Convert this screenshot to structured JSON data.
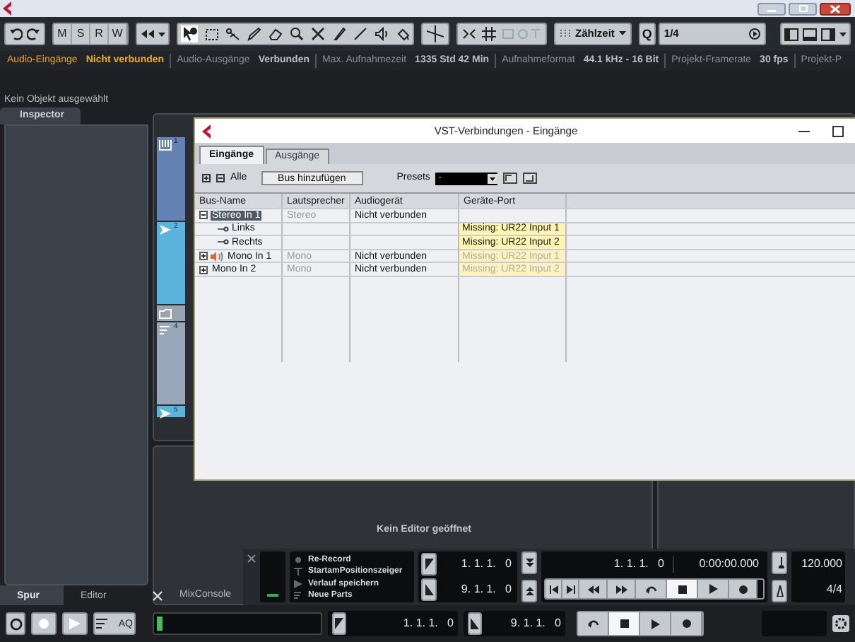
{
  "toolbar": {
    "automation_buttons": [
      "M",
      "S",
      "R",
      "W"
    ],
    "time_format": "Zählzeit",
    "quantize_label": "Q",
    "quantize_value": "1/4"
  },
  "info_line": [
    {
      "label": "Audio-Eingänge",
      "value": "Nicht verbunden",
      "warning": true
    },
    {
      "label": "Audio-Ausgänge",
      "value": "Verbunden",
      "warning": false
    },
    {
      "label": "Max. Aufnahmezeit",
      "value": "1335 Std 42 Min",
      "warning": false
    },
    {
      "label": "Aufnahmeformat",
      "value": "44.1 kHz - 16 Bit",
      "warning": false
    },
    {
      "label": "Projekt-Framerate",
      "value": "30 fps",
      "warning": false
    },
    {
      "label": "Projekt-P",
      "warning": false
    }
  ],
  "status": "Kein Objekt ausgewählt",
  "inspector_tab": "Inspector",
  "tracks": [
    {
      "number": "1",
      "kind": "instrument",
      "color": "#6482b4"
    },
    {
      "number": "2",
      "kind": "audio",
      "color": "#5ab4dc"
    },
    {
      "kind": "folder",
      "color": "#9aa4ae"
    },
    {
      "number": "4",
      "kind": "midi",
      "color": "#98a8ba"
    },
    {
      "number": "5",
      "kind": "audio",
      "color": "#5ab4dc"
    }
  ],
  "dialog": {
    "title": "VST-Verbindungen - Eingänge",
    "tabs": [
      {
        "label": "Eingänge",
        "selected": true
      },
      {
        "label": "Ausgänge",
        "selected": false
      }
    ],
    "expand_label": "Alle",
    "add_button": "Bus hinzufügen",
    "presets_label": "Presets",
    "presets_value": "-",
    "columns": [
      "Bus-Name",
      "Lautsprecher",
      "Audiogerät",
      "Geräte-Port"
    ],
    "rows": [
      {
        "name": "Stereo In 1",
        "speaker": "Stereo",
        "device": "Nicht verbunden",
        "selected": true,
        "expanded": true,
        "monitor": false,
        "children": [
          {
            "name": "Links",
            "port": "Missing: UR22 Input 1",
            "active": true
          },
          {
            "name": "Rechts",
            "port": "Missing: UR22 Input 2",
            "active": true
          }
        ]
      },
      {
        "name": "Mono In 1",
        "speaker": "Mono",
        "device": "Nicht verbunden",
        "port": "Missing: UR22 Input 1",
        "active": false,
        "selected": false,
        "expanded": false,
        "monitor": true
      },
      {
        "name": "Mono In 2",
        "speaker": "Mono",
        "device": "Nicht verbunden",
        "port": "Missing: UR22 Input 2",
        "active": false,
        "selected": false,
        "expanded": false,
        "monitor": false
      }
    ]
  },
  "editor_message": "Kein Editor geöffnet",
  "bottom_tabs": [
    {
      "label": "Spur",
      "selected": true
    },
    {
      "label": "Editor",
      "selected": false
    },
    {
      "label": "MixConsole",
      "selected": false
    }
  ],
  "transport": {
    "record_modes": [
      "Re-Record",
      "StartamPositionszeiger",
      "Verlauf speichern",
      "Neue Parts"
    ],
    "left_locator": "1. 1. 1.   0",
    "right_locator": "9. 1. 1.   0",
    "position_bars": "1. 1. 1.   0",
    "position_time": "0:00:00.000",
    "tempo": "120.000",
    "signature": "4/4"
  },
  "bottom_bar": {
    "aq": "AQ",
    "left_locator": "1. 1. 1.   0",
    "right_locator": "9. 1. 1.   0"
  }
}
